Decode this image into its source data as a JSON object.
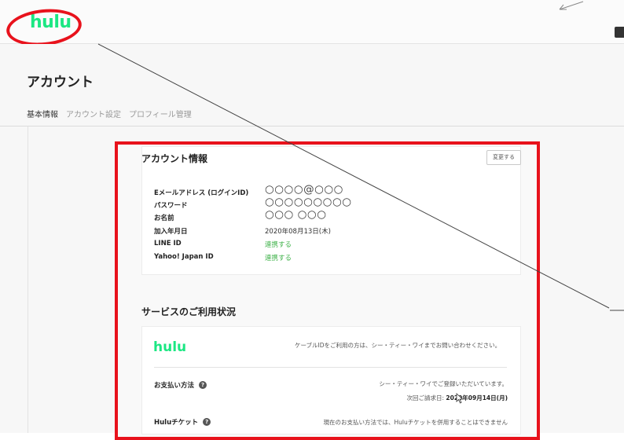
{
  "header": {
    "logo": "hulu"
  },
  "page": {
    "title": "アカウント"
  },
  "tabs": [
    {
      "label": "基本情報",
      "active": true
    },
    {
      "label": "アカウント設定",
      "active": false
    },
    {
      "label": "プロフィール管理",
      "active": false
    }
  ],
  "account": {
    "title": "アカウント情報",
    "change_label": "変更する",
    "rows": [
      {
        "label": "Eメールアドレス (ログインID)",
        "value": "○○○○@○○○"
      },
      {
        "label": "パスワード",
        "value": "○○○○○○○○○"
      },
      {
        "label": "お名前",
        "value": "○○○ ○○○"
      },
      {
        "label": "加入年月日",
        "value": "2020年08月13日(木)"
      },
      {
        "label": "LINE ID",
        "value": "連携する"
      },
      {
        "label": "Yahoo! Japan ID",
        "value": "連携する"
      }
    ]
  },
  "service": {
    "title": "サービスのご利用状況",
    "logo": "hulu",
    "note": "ケーブルIDをご利用の方は、シー・ティー・ワイまでお問い合わせください。",
    "payment_label": "お支払い方法",
    "payment_value": "シー・ティー・ワイでご登録いただいています。",
    "next_billing_prefix": "次回ご請求日",
    "next_billing_date": "2020年09月14日(月)",
    "ticket_label": "Huluチケット",
    "ticket_value": "現在のお支払い方法では、Huluチケットを併用することはできません"
  },
  "colors": {
    "brand": "#1ce783",
    "highlight": "#e8121c",
    "link": "#3fb24a"
  }
}
